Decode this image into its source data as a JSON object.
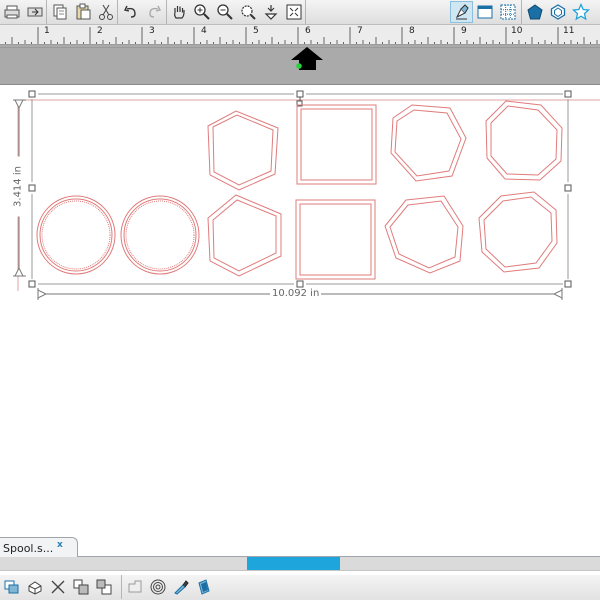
{
  "ruler": {
    "numbers": [
      "1",
      "2",
      "3",
      "4",
      "5",
      "6",
      "7",
      "8",
      "9",
      "10",
      "11"
    ]
  },
  "dimensions": {
    "height_label": "3.414 in",
    "width_label": "10.092 in"
  },
  "document_tab": {
    "label": "Spool.s...",
    "close_glyph": "x"
  },
  "toolbar": {
    "icons": [
      "print-icon",
      "print-send-icon",
      "copy-icon",
      "paste-icon",
      "scissors-icon",
      "undo-icon",
      "redo-icon",
      "pan-hand-icon",
      "zoom-in-icon",
      "zoom-out-icon",
      "zoom-select-icon",
      "zoom-fit-icon",
      "fit-page-icon",
      "select-tool-icon",
      "page-view-icon",
      "grid-view-icon",
      "pentagon-icon",
      "hexagon-icon",
      "star-icon"
    ]
  },
  "bottom_toolbar": {
    "icons": [
      "group-icon",
      "ungroup-icon",
      "delete-icon",
      "bring-forward-icon",
      "send-back-icon",
      "weld-icon",
      "offset-icon",
      "knife-icon",
      "trace-icon"
    ]
  },
  "colors": {
    "accent": "#1ea5db",
    "shape_stroke": "#e07b7b",
    "toolbar_active": "#cfe6f3",
    "paper_band": "#aaaaaa"
  }
}
